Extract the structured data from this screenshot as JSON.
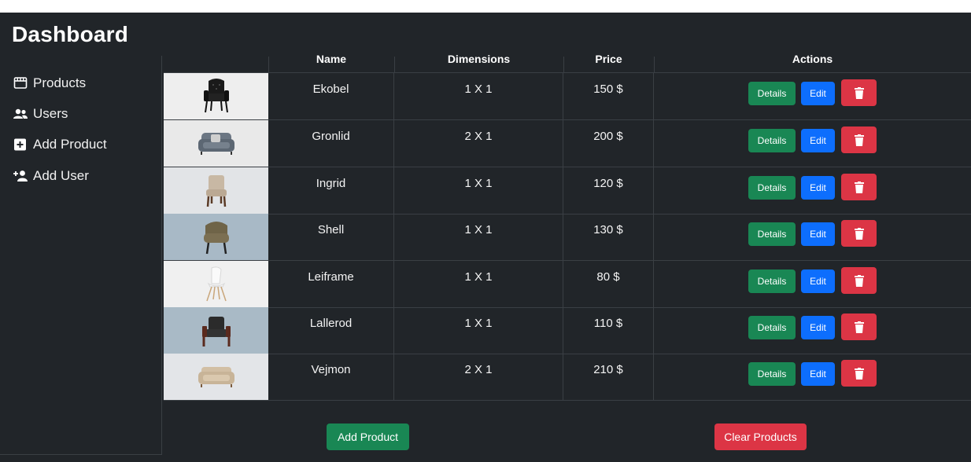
{
  "header": {
    "title": "Dashboard"
  },
  "sidebar": {
    "items": [
      {
        "label": "Products",
        "icon": "store-icon"
      },
      {
        "label": "Users",
        "icon": "users-icon"
      },
      {
        "label": "Add Product",
        "icon": "plus-square-icon"
      },
      {
        "label": "Add User",
        "icon": "user-plus-icon"
      }
    ]
  },
  "table": {
    "columns": [
      "",
      "Name",
      "Dimensions",
      "Price",
      "Actions"
    ],
    "rows": [
      {
        "name": "Ekobel",
        "dimensions": "1 X 1",
        "price": "150 $",
        "image": "black-tufted-armchair"
      },
      {
        "name": "Gronlid",
        "dimensions": "2 X 1",
        "price": "200 $",
        "image": "grey-loveseat"
      },
      {
        "name": "Ingrid",
        "dimensions": "1 X 1",
        "price": "120 $",
        "image": "beige-wood-chair"
      },
      {
        "name": "Shell",
        "dimensions": "1 X 1",
        "price": "130 $",
        "image": "olive-shell-armchair"
      },
      {
        "name": "Leiframe",
        "dimensions": "1 X 1",
        "price": "80 $",
        "image": "white-plastic-chair"
      },
      {
        "name": "Lallerod",
        "dimensions": "1 X 1",
        "price": "110 $",
        "image": "black-leather-armchair"
      },
      {
        "name": "Vejmon",
        "dimensions": "2 X 1",
        "price": "210 $",
        "image": "beige-sofa"
      }
    ],
    "actions": {
      "details": "Details",
      "edit": "Edit",
      "delete_icon": "trash-icon"
    }
  },
  "footer": {
    "add_label": "Add Product",
    "clear_label": "Clear Products"
  },
  "colors": {
    "background": "#212529",
    "success": "#198754",
    "primary": "#0d6efd",
    "danger": "#dc3545"
  }
}
